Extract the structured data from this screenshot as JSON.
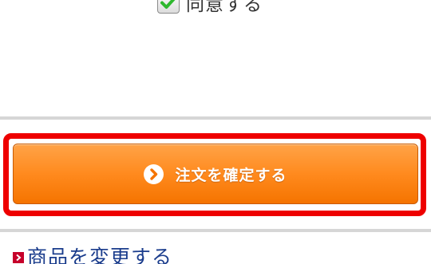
{
  "agree": {
    "checked": true,
    "label": "同意する"
  },
  "confirm": {
    "label": "注文を確定する",
    "icon": "chevron-right-circle-icon"
  },
  "change_link": {
    "label": "商品を変更する",
    "icon": "red-arrow-box-icon"
  },
  "colors": {
    "button_orange": "#ff8a1e",
    "highlight_red": "#ee0000",
    "link_blue": "#1a3c8c",
    "check_green": "#2eb82e"
  }
}
